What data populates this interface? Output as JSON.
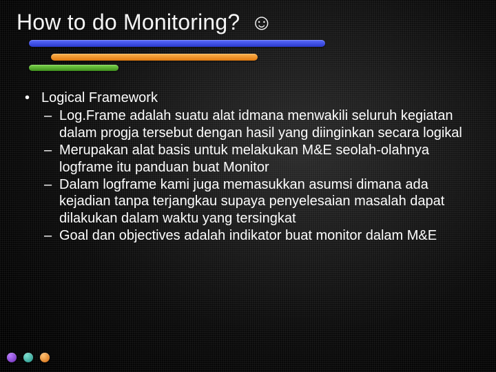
{
  "title": "How to do Monitoring?",
  "smiley": "☺",
  "bullets": {
    "main": "Logical Framework",
    "subs": [
      "Log.Frame adalah suatu alat idmana menwakili seluruh kegiatan dalam progja tersebut dengan hasil yang diinginkan secara logikal",
      "Merupakan alat basis untuk melakukan M&E seolah-olahnya logframe itu panduan buat Monitor",
      "Dalam logframe kami juga memasukkan asumsi dimana ada kejadian tanpa terjangkau supaya penyelesaian masalah dapat dilakukan dalam waktu yang tersingkat",
      "Goal dan objectives adalah indikator buat monitor dalam M&E"
    ]
  }
}
